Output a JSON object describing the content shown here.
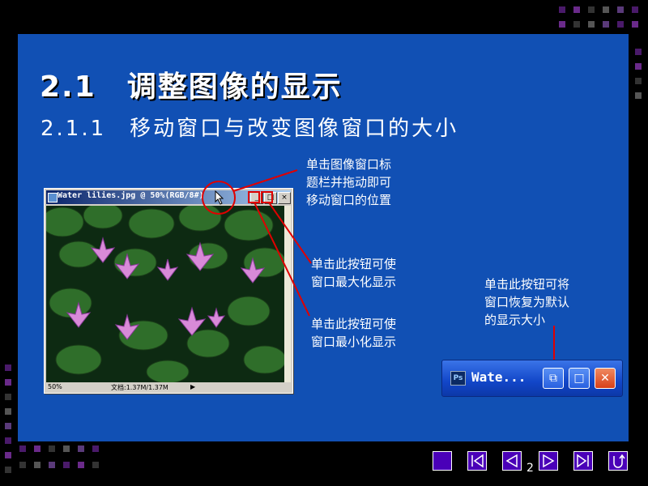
{
  "slide": {
    "title": "2.1　调整图像的显示",
    "subtitle": "2.1.1　移动窗口与改变图像窗口的大小",
    "page_number": "2"
  },
  "photoshop_window": {
    "title": "Water lilies.jpg @ 50%(RGB/8#)",
    "zoom": "50%",
    "doc_info": "文档:1.37M/1.37M",
    "minimize_label": "_",
    "restore_label": "□",
    "close_label": "×"
  },
  "minimized_window": {
    "icon_label": "Ps",
    "title": "Wate...",
    "restore_label": "⧉",
    "maximize_label": "□",
    "close_label": "✕"
  },
  "annotations": {
    "drag_title": "单击图像窗口标\n题栏并拖动即可\n移动窗口的位置",
    "maximize": "单击此按钮可使\n窗口最大化显示",
    "minimize": "单击此按钮可使\n窗口最小化显示",
    "restore": "单击此按钮可将\n窗口恢复为默认\n的显示大小"
  },
  "colors": {
    "slide_bg": "#1150B4",
    "nav_purple": "#4a00b8",
    "callout_red": "#e00000"
  },
  "icons": [
    "cursor-arrow-icon",
    "photoshop-icon",
    "first-slide-icon",
    "previous-slide-icon",
    "next-slide-icon",
    "last-slide-icon",
    "return-icon"
  ]
}
